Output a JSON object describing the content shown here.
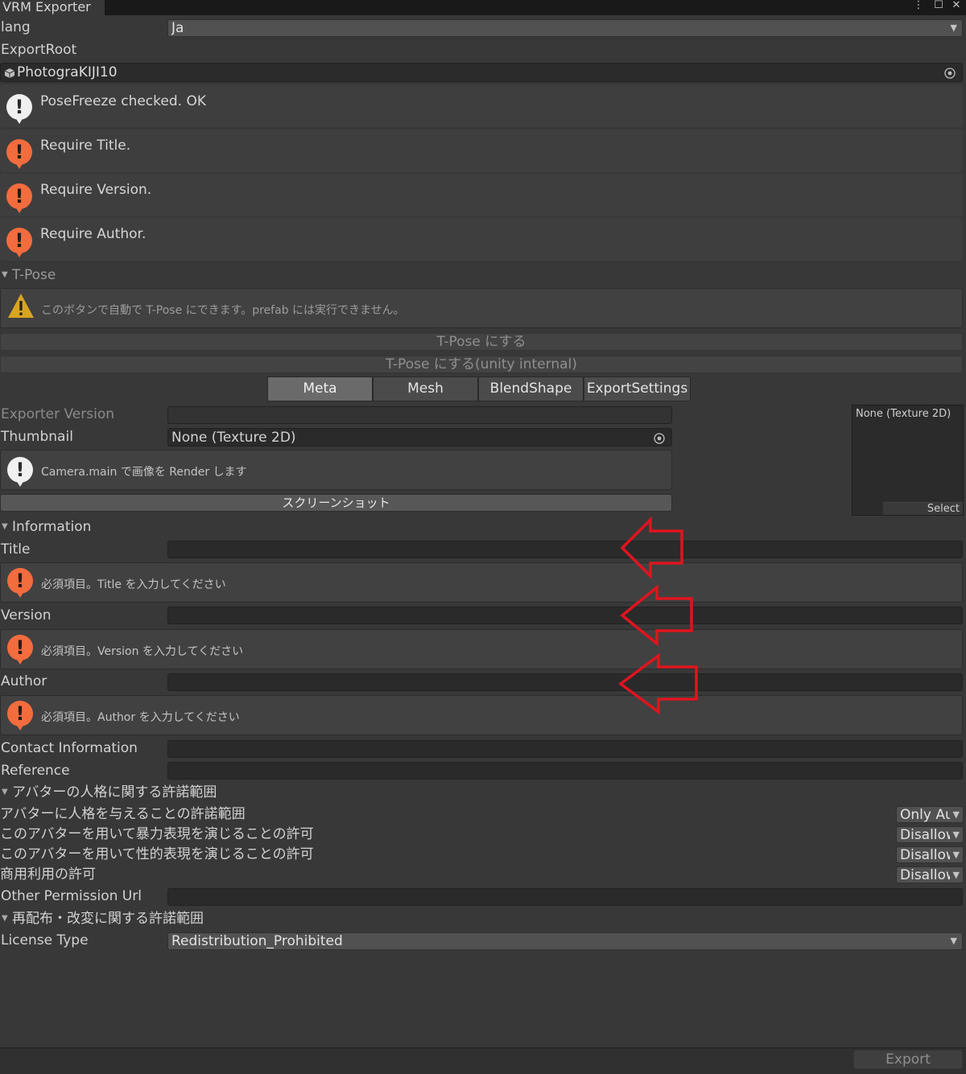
{
  "window": {
    "title": "VRM Exporter",
    "menu_icon": "⋮",
    "maximize_icon": "☐",
    "close_icon": "✕"
  },
  "lang": {
    "label": "lang",
    "value": "Ja"
  },
  "export_root": {
    "label": "ExportRoot",
    "value": "PhotograKIJI10"
  },
  "validation": [
    {
      "type": "info",
      "text": "PoseFreeze checked. OK"
    },
    {
      "type": "error",
      "text": "Require Title."
    },
    {
      "type": "error",
      "text": "Require Version."
    },
    {
      "type": "error",
      "text": "Require Author."
    }
  ],
  "tpose": {
    "header": "T-Pose",
    "warning": "このボタンで自動で T-Pose にできます。prefab には実行できません。",
    "button1": "T-Pose にする",
    "button2": "T-Pose にする(unity internal)"
  },
  "tabs": [
    "Meta",
    "Mesh",
    "BlendShape",
    "ExportSettings"
  ],
  "meta": {
    "exporter_version_label": "Exporter Version",
    "thumbnail_label": "Thumbnail",
    "thumbnail_value": "None (Texture 2D)",
    "camera_info": "Camera.main で画像を Render します",
    "screenshot_button": "スクリーンショット",
    "preview_label": "None (Texture 2D)",
    "preview_select": "Select"
  },
  "information": {
    "header": "Information",
    "title_label": "Title",
    "title_error": "必須項目。Title を入力してください",
    "version_label": "Version",
    "version_error": "必須項目。Version を入力してください",
    "author_label": "Author",
    "author_error": "必須項目。Author を入力してください",
    "contact_label": "Contact Information",
    "reference_label": "Reference"
  },
  "personation": {
    "header": "アバターの人格に関する許諾範囲",
    "rows": [
      {
        "label": "アバターに人格を与えることの許諾範囲",
        "value": "Only Author"
      },
      {
        "label": "このアバターを用いて暴力表現を演じることの許可",
        "value": "Disallow"
      },
      {
        "label": "このアバターを用いて性的表現を演じることの許可",
        "value": "Disallow"
      },
      {
        "label": "商用利用の許可",
        "value": "Disallow"
      }
    ],
    "other_permission_label": "Other Permission Url"
  },
  "redistribution": {
    "header": "再配布・改変に関する許諾範囲",
    "license_label": "License Type",
    "license_value": "Redistribution_Prohibited"
  },
  "footer": {
    "export_button": "Export"
  },
  "colors": {
    "background": "#383838",
    "error_icon": "#f26c3e",
    "warning_icon": "#d9a420",
    "annotation_arrow": "#e0141e"
  }
}
